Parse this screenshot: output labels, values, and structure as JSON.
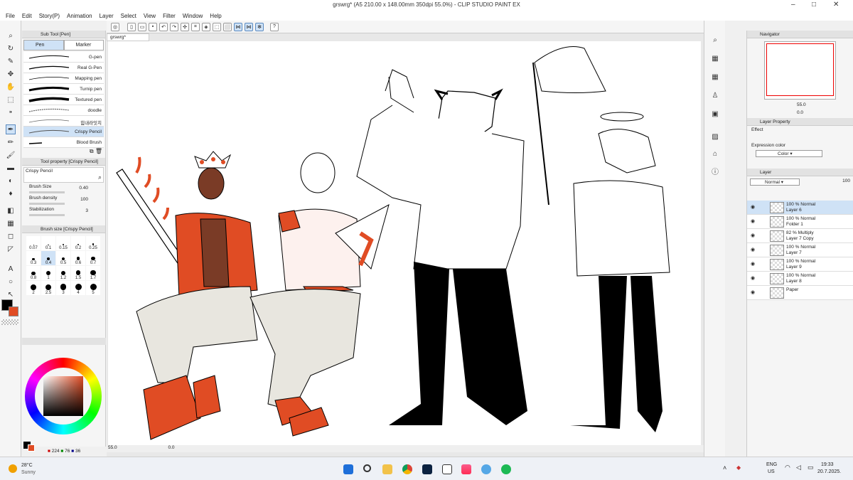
{
  "window": {
    "title": "grswrg* (A5 210.00 x 148.00mm 350dpi 55.0%) - CLIP STUDIO PAINT EX"
  },
  "menu": [
    "File",
    "Edit",
    "Story(P)",
    "Animation",
    "Layer",
    "Select",
    "View",
    "Filter",
    "Window",
    "Help"
  ],
  "subtool": {
    "header": "Sub Tool [Pen]",
    "tabs": [
      "Pen",
      "Marker"
    ],
    "brushes": [
      {
        "label": "G-pen"
      },
      {
        "label": "Real G-Pen"
      },
      {
        "label": "Mapping pen"
      },
      {
        "label": "Turnip pen"
      },
      {
        "label": "Textured pen"
      },
      {
        "label": "doodle"
      },
      {
        "label": "힘내라잇치"
      },
      {
        "label": "Crispy Pencil"
      },
      {
        "label": "Blood Brush"
      }
    ]
  },
  "toolprop": {
    "header": "Tool property [Crispy Pencil]",
    "name": "Crispy Pencil",
    "brush_size_label": "Brush Size",
    "brush_size": "0.40",
    "brush_density_label": "Brush density",
    "brush_density": "100",
    "stabilization_label": "Stabilization",
    "stabilization": "3"
  },
  "brushsize": {
    "header": "Brush size [Crispy Pencil]",
    "sizes": [
      "0.07",
      "0.1",
      "0.15",
      "0.2",
      "0.25",
      "0.3",
      "0.4",
      "0.5",
      "0.6",
      "0.7",
      "0.8",
      "1",
      "1.2",
      "1.5",
      "1.7",
      "2",
      "2.5",
      "3",
      "4",
      "5"
    ]
  },
  "color": {
    "r": "224",
    "g": "76",
    "b": "36",
    "main": "#000000",
    "sub": "#e04c24"
  },
  "doc_tab": "grswrg*",
  "statusbar": {
    "zoom": "55.0",
    "angle": "0.0"
  },
  "navigator": {
    "header": "Navigator",
    "zoom": "55.0",
    "angle": "0.0"
  },
  "layer_property": {
    "header": "Layer Property",
    "effect_label": "Effect",
    "expression_label": "Expression color",
    "expression_value": "Color"
  },
  "layers": {
    "header": "Layer",
    "blend": "Normal",
    "opacity": "100",
    "items": [
      {
        "t1": "100 % Normal",
        "t2": "Layer 6",
        "sel": true
      },
      {
        "t1": "100 % Normal",
        "t2": "Folder 1"
      },
      {
        "t1": "82 % Multiply",
        "t2": "Layer 7 Copy"
      },
      {
        "t1": "100 % Normal",
        "t2": "Layer 7"
      },
      {
        "t1": "100 % Normal",
        "t2": "Layer 9"
      },
      {
        "t1": "100 % Normal",
        "t2": "Layer 8"
      },
      {
        "t1": "Paper",
        "t2": ""
      }
    ]
  },
  "taskbar": {
    "weather_temp": "28°C",
    "weather_desc": "Sunny",
    "lang1": "ENG",
    "lang2": "US",
    "time": "19:33",
    "date": "20.7.2025."
  }
}
